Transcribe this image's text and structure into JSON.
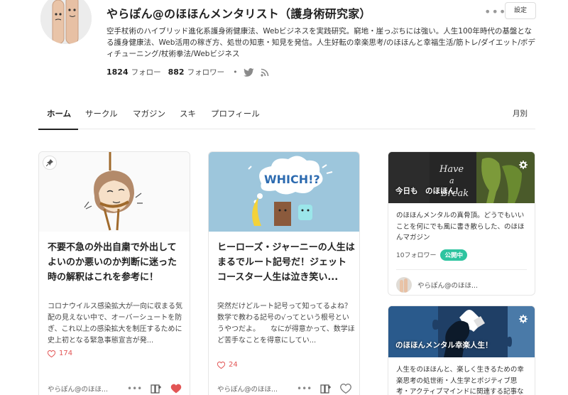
{
  "profile": {
    "name": "やらぽん@のほほんメンタリスト（護身術研究家）",
    "bio": "空手杖術のハイブリッド進化系護身術健康法、Webビジネスを実践研究。窮地・崖っぷちには強い。人生100年時代の基盤となる護身健康法、Web活用の稼ぎ方、処世の知恵・知見を発信。人生好転の幸楽思考/のほほんと幸福生活/筋トレ/ダイエット/ボディチューニング/杖術拳法/Webビジネス",
    "follow_count": "1824",
    "follow_label": "フォロー",
    "follower_count": "882",
    "follower_label": "フォロワー",
    "settings_label": "設定",
    "more_label": "•••"
  },
  "tabs": [
    {
      "label": "ホーム",
      "active": true
    },
    {
      "label": "サークル"
    },
    {
      "label": "マガジン"
    },
    {
      "label": "スキ"
    },
    {
      "label": "プロフィール"
    }
  ],
  "monthly_label": "月別",
  "articles": [
    {
      "title": "不要不急の外出自粛で外出してよいのか悪いのか判断に迷った時の解釈はこれを参考に！",
      "excerpt": "コロナウイルス感染拡大が一向に収まる気配の見えない中で、オーバーシュートを防ぎ、これ以上の感染拡大を制圧するために史上初となる緊急事態宣言が発...",
      "likes": "174",
      "author": "やらぽん@のほほ...",
      "liked": true
    },
    {
      "title": "ヒーローズ・ジャーニーの人生はまるでルート記号だ！ジェットコースター人生は泣き笑い...",
      "excerpt": "突然だけどルート記号って知ってるよね？ 数学で教わる記号の√ってという根号というやつだよ。　　なにが得意かって、数学ほど苦手なことを得意にしてい...",
      "likes": "24",
      "author": "やらぽん@のほほ...",
      "liked": false,
      "thumb_text": "WHICH!?"
    }
  ],
  "magazines": [
    {
      "title": "今日も　のほほん！",
      "board_text": [
        "Have",
        "a",
        "Break"
      ],
      "desc": "のほほんメンタルの真骨頂。どうでもいいことを何にでも風に書き散らした、のほほんマガジン",
      "followers": "10フォロワー",
      "badge": "公開中",
      "author": "やらぽん@のほほ..."
    },
    {
      "title": "のほほんメンタル幸楽人生！",
      "desc": "人生をのほほんと、楽しく生きるための幸楽思考の処世術・人生学とポジティブ思考・アクティブマインドに関連する記事など、価"
    }
  ],
  "colors": {
    "accent": "#2ec4a0",
    "like": "#e25555"
  }
}
